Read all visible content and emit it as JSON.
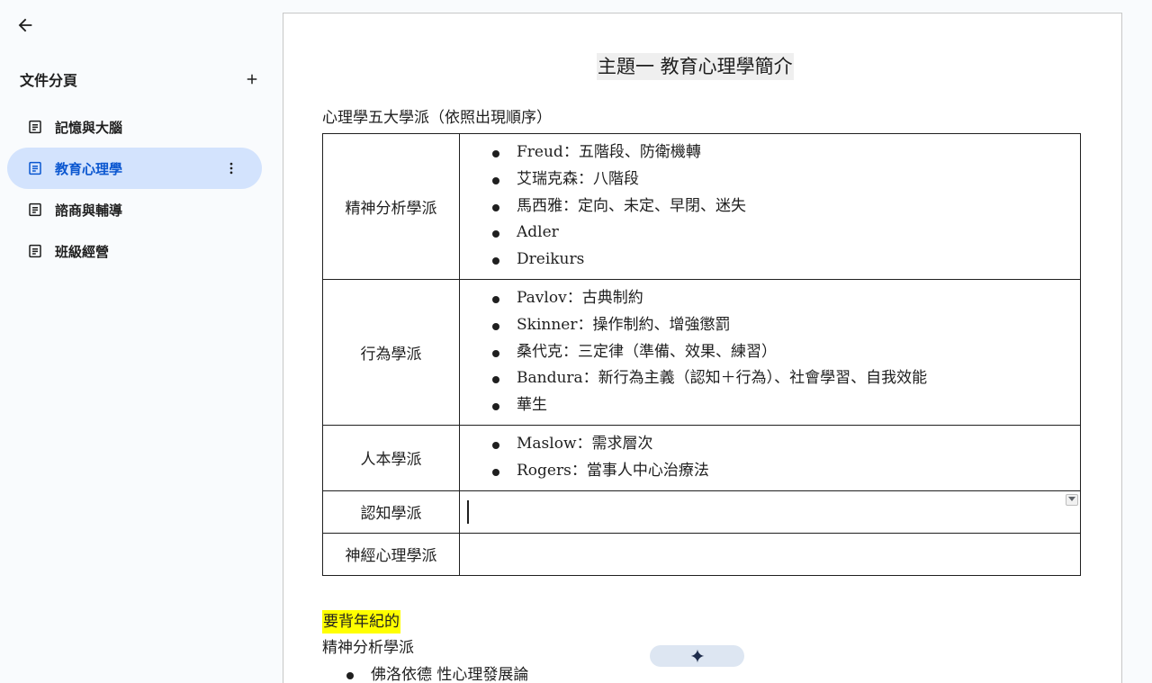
{
  "sidebar": {
    "title": "文件分頁",
    "tabs": [
      {
        "label": "記憶與大腦"
      },
      {
        "label": "教育心理學"
      },
      {
        "label": "諮商與輔導"
      },
      {
        "label": "班級經營"
      }
    ],
    "active_index": 1
  },
  "document": {
    "title": "主題一 教育心理學簡介",
    "section_heading": "心理學五大學派（依照出現順序）",
    "schools": [
      {
        "name": "精神分析學派",
        "items": [
          "Freud：五階段、防衛機轉",
          "艾瑞克森：八階段",
          "馬西雅：定向、未定、早閉、迷失",
          "Adler",
          "Dreikurs"
        ]
      },
      {
        "name": "行為學派",
        "items": [
          "Pavlov：古典制約",
          "Skinner：操作制約、增強懲罰",
          "桑代克：三定律（準備、效果、練習）",
          "Bandura：新行為主義（認知＋行為）、社會學習、自我效能",
          "華生"
        ]
      },
      {
        "name": "人本學派",
        "items": [
          "Maslow：需求層次",
          "Rogers：當事人中心治療法"
        ]
      },
      {
        "name": "認知學派",
        "items": []
      },
      {
        "name": "神經心理學派",
        "items": []
      }
    ],
    "highlight_text": "要背年紀的",
    "subheading": "精神分析學派",
    "bottom_items": [
      "佛洛依德 性心理發展論"
    ]
  },
  "colors": {
    "active_tab_bg": "#d3e3fd",
    "active_tab_text": "#0b57d0",
    "highlight": "#ffff00",
    "title_bg": "#efefef"
  },
  "icons": {
    "back": "arrow-left-icon",
    "add": "plus-icon",
    "tab": "document-icon",
    "more": "more-vertical-icon",
    "gemini": "sparkle-icon"
  }
}
